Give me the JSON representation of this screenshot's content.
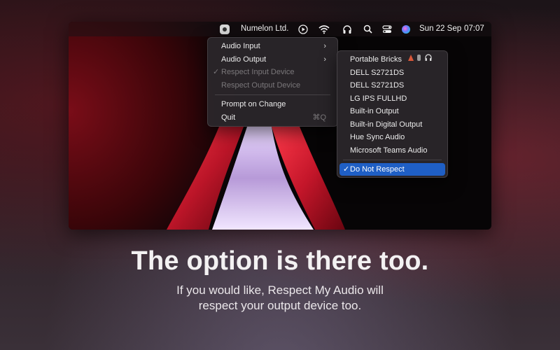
{
  "menubar": {
    "app_name": "Numelon Ltd.",
    "date": "Sun 22 Sep",
    "time": "07:07",
    "icons": [
      "app-icon",
      "play-icon",
      "wifi-icon",
      "headphones-icon",
      "search-icon",
      "control-center-icon",
      "siri-icon"
    ]
  },
  "menu": {
    "items": [
      {
        "label": "Audio Input"
      },
      {
        "label": "Audio Output"
      },
      {
        "label": "Respect Input Device"
      },
      {
        "label": "Respect Output Device"
      },
      {
        "label": "Prompt on Change"
      },
      {
        "label": "Quit",
        "shortcut": "⌘Q"
      }
    ],
    "check_mark": "✓"
  },
  "submenu": {
    "items": [
      {
        "label": "Portable Bricks"
      },
      {
        "label": "DELL S2721DS"
      },
      {
        "label": "DELL S2721DS"
      },
      {
        "label": "LG IPS FULLHD"
      },
      {
        "label": "Built-in Output"
      },
      {
        "label": "Built-in Digital Output"
      },
      {
        "label": "Hue Sync Audio"
      },
      {
        "label": "Microsoft Teams Audio"
      }
    ],
    "selected": {
      "label": "Do Not Respect"
    },
    "check_mark": "✓"
  },
  "hero": {
    "title": "The option is there too.",
    "subtitle_line1": "If you would like, Respect My Audio will",
    "subtitle_line2": "respect your output device too."
  },
  "colors": {
    "selection": "#1f5fc5",
    "wallpaper_red": "#7a0d18"
  }
}
